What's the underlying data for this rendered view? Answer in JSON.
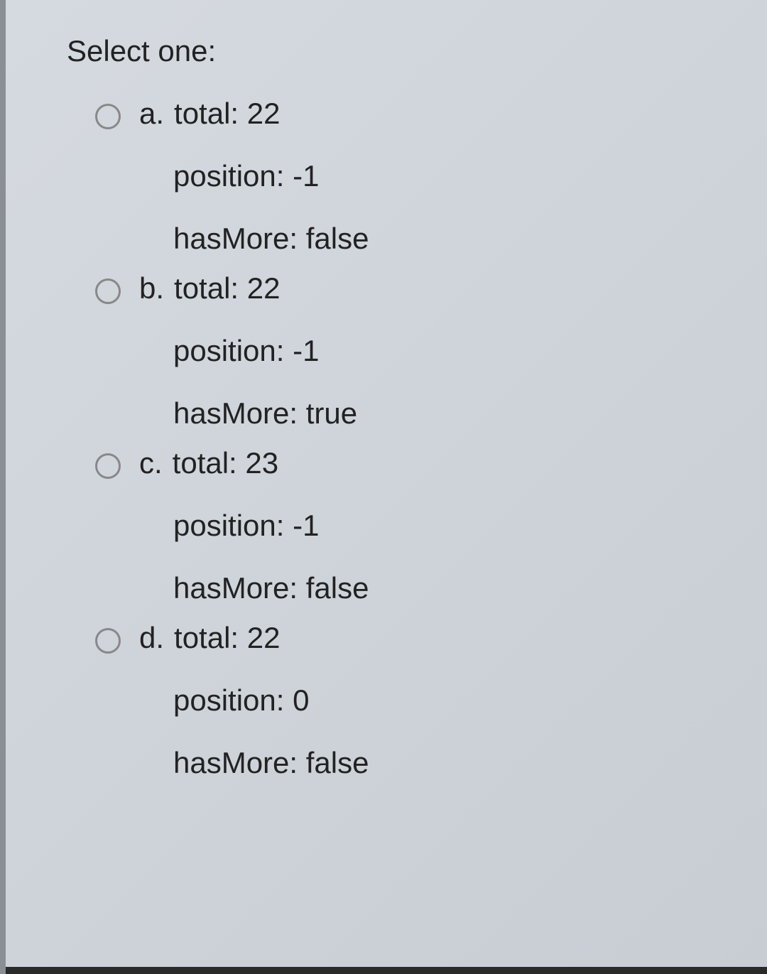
{
  "prompt": "Select one:",
  "options": [
    {
      "letter": "a.",
      "line1": "total: 22",
      "line2": "position: -1",
      "line3": "hasMore: false"
    },
    {
      "letter": "b.",
      "line1": "total: 22",
      "line2": "position: -1",
      "line3": "hasMore: true"
    },
    {
      "letter": "c.",
      "line1": "total: 23",
      "line2": "position: -1",
      "line3": "hasMore: false"
    },
    {
      "letter": "d.",
      "line1": "total: 22",
      "line2": "position: 0",
      "line3": "hasMore: false"
    }
  ]
}
